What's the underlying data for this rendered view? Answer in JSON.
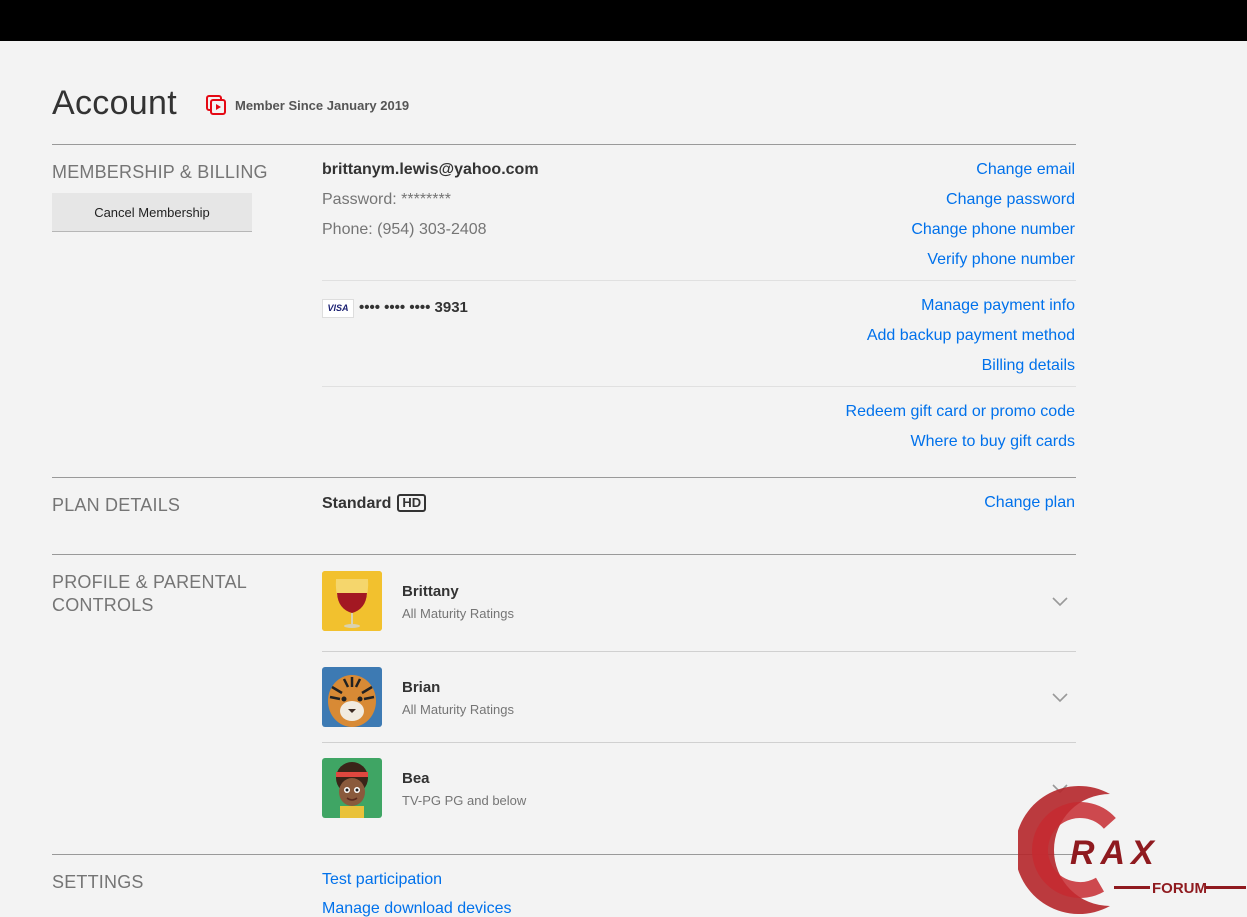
{
  "header": {
    "title": "Account",
    "member_since": "Member Since January 2019"
  },
  "membership": {
    "section_label": "MEMBERSHIP & BILLING",
    "cancel_label": "Cancel Membership",
    "email": "brittanym.lewis@yahoo.com",
    "password": "Password: ********",
    "phone": "Phone: (954) 303-2408",
    "links_account": [
      "Change email",
      "Change password",
      "Change phone number",
      "Verify phone number"
    ],
    "card_brand": "VISA",
    "card_masked": "•••• •••• •••• 3931",
    "links_payment": [
      "Manage payment info",
      "Add backup payment method",
      "Billing details"
    ],
    "links_gift": [
      "Redeem gift card or promo code",
      "Where to buy gift cards"
    ]
  },
  "plan": {
    "section_label": "PLAN DETAILS",
    "name": "Standard",
    "badge": "HD",
    "change_label": "Change plan"
  },
  "profiles": {
    "section_label_1": "PROFILE & PARENTAL",
    "section_label_2": "CONTROLS",
    "items": [
      {
        "name": "Brittany",
        "rating": "All Maturity Ratings",
        "avatar": "wine-glass-avatar"
      },
      {
        "name": "Brian",
        "rating": "All Maturity Ratings",
        "avatar": "tiger-avatar"
      },
      {
        "name": "Bea",
        "rating": "TV-PG PG and below",
        "avatar": "kid-avatar"
      }
    ]
  },
  "settings": {
    "section_label": "SETTINGS",
    "links": [
      "Test participation",
      "Manage download devices"
    ]
  },
  "watermark": {
    "line1": "RAX",
    "line2": "FORUM"
  },
  "colors": {
    "link": "#0071eb",
    "accent": "#e50914",
    "topbar": "#000000",
    "background": "#f3f3f3"
  }
}
